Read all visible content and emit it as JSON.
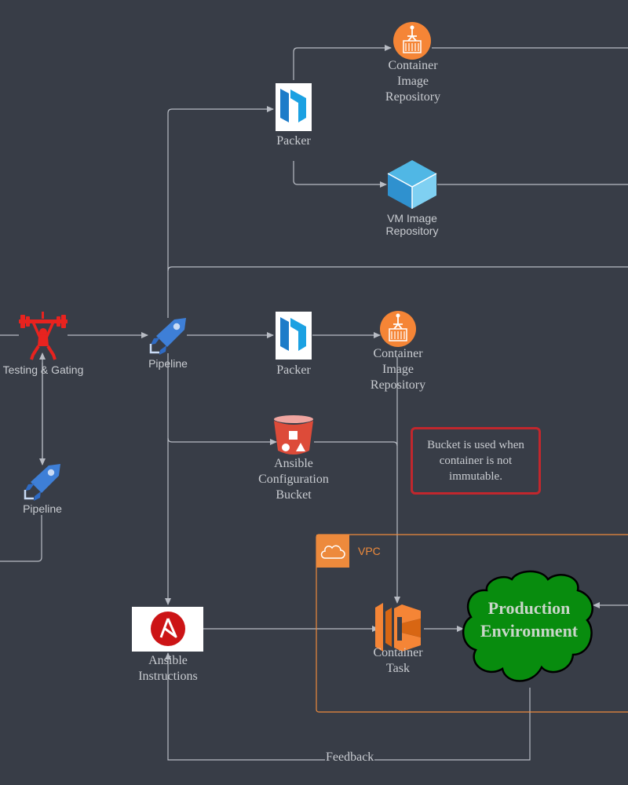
{
  "nodes": {
    "container_repo_top": "Container\nImage\nRepository",
    "packer_top": "Packer",
    "vm_image_repo": "VM Image\nRepository",
    "testing_gating": "Testing & Gating",
    "pipeline_main": "Pipeline",
    "packer_mid": "Packer",
    "container_repo_mid": "Container\nImage\nRepository",
    "ansible_bucket": "Ansible\nConfiguration\nBucket",
    "pipeline_lower": "Pipeline",
    "ansible_instructions": "Ansible\nInstructions",
    "container_task": "Container\nTask",
    "production_env": "Production\nEnvironment"
  },
  "note": "Bucket is used when container is not immutable.",
  "vpc_label": "VPC",
  "edge_labels": {
    "feedback": "Feedback"
  },
  "colors": {
    "background": "#383d47",
    "line": "#b8bcc4",
    "packer_blue": "#1ba1e2",
    "ecr_orange": "#f58536",
    "bucket_red": "#dd4b39",
    "ansible_red": "#cc1416",
    "vpc_orange": "#ed8a3c",
    "production_green": "#088c0e",
    "note_border": "#c1272d"
  }
}
